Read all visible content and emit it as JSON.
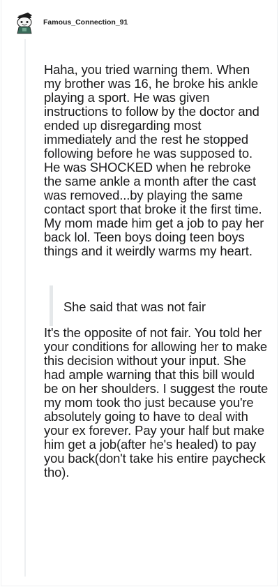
{
  "comment": {
    "author": {
      "username": "Famous_Connection_91",
      "avatar_icon": "snoo-avatar-icon"
    },
    "paragraphs": {
      "first": "Haha, you tried warning them. When my brother was 16, he broke his ankle playing a sport. He was given instructions to follow by the doctor and ended up disregarding most immediately and the rest he stopped following before he was supposed to. He was SHOCKED when he rebroke the same ankle a month after the cast was removed...by playing the same contact sport that broke it the first time. My mom made him get a job to pay her back lol. Teen boys doing teen boys things and it weirdly warms my heart.",
      "quote": "She said that was not fair",
      "second": "It's the opposite of not fair. You told her your conditions for allowing her to make this decision without your input. She had ample warning that this bill would be on her shoulders. I suggest the route my mom took tho just because you're absolutely going to have to deal with your ex forever. Pay your half but make him get a job(after he's healed) to pay you back(don't take his entire paycheck tho)."
    }
  },
  "colors": {
    "text": "#1a1a1b",
    "thread_line": "#edeff1",
    "quote_bar": "#e5e8ea",
    "avatar_primary": "#3a6b5a",
    "avatar_dark": "#1c1c1c"
  }
}
